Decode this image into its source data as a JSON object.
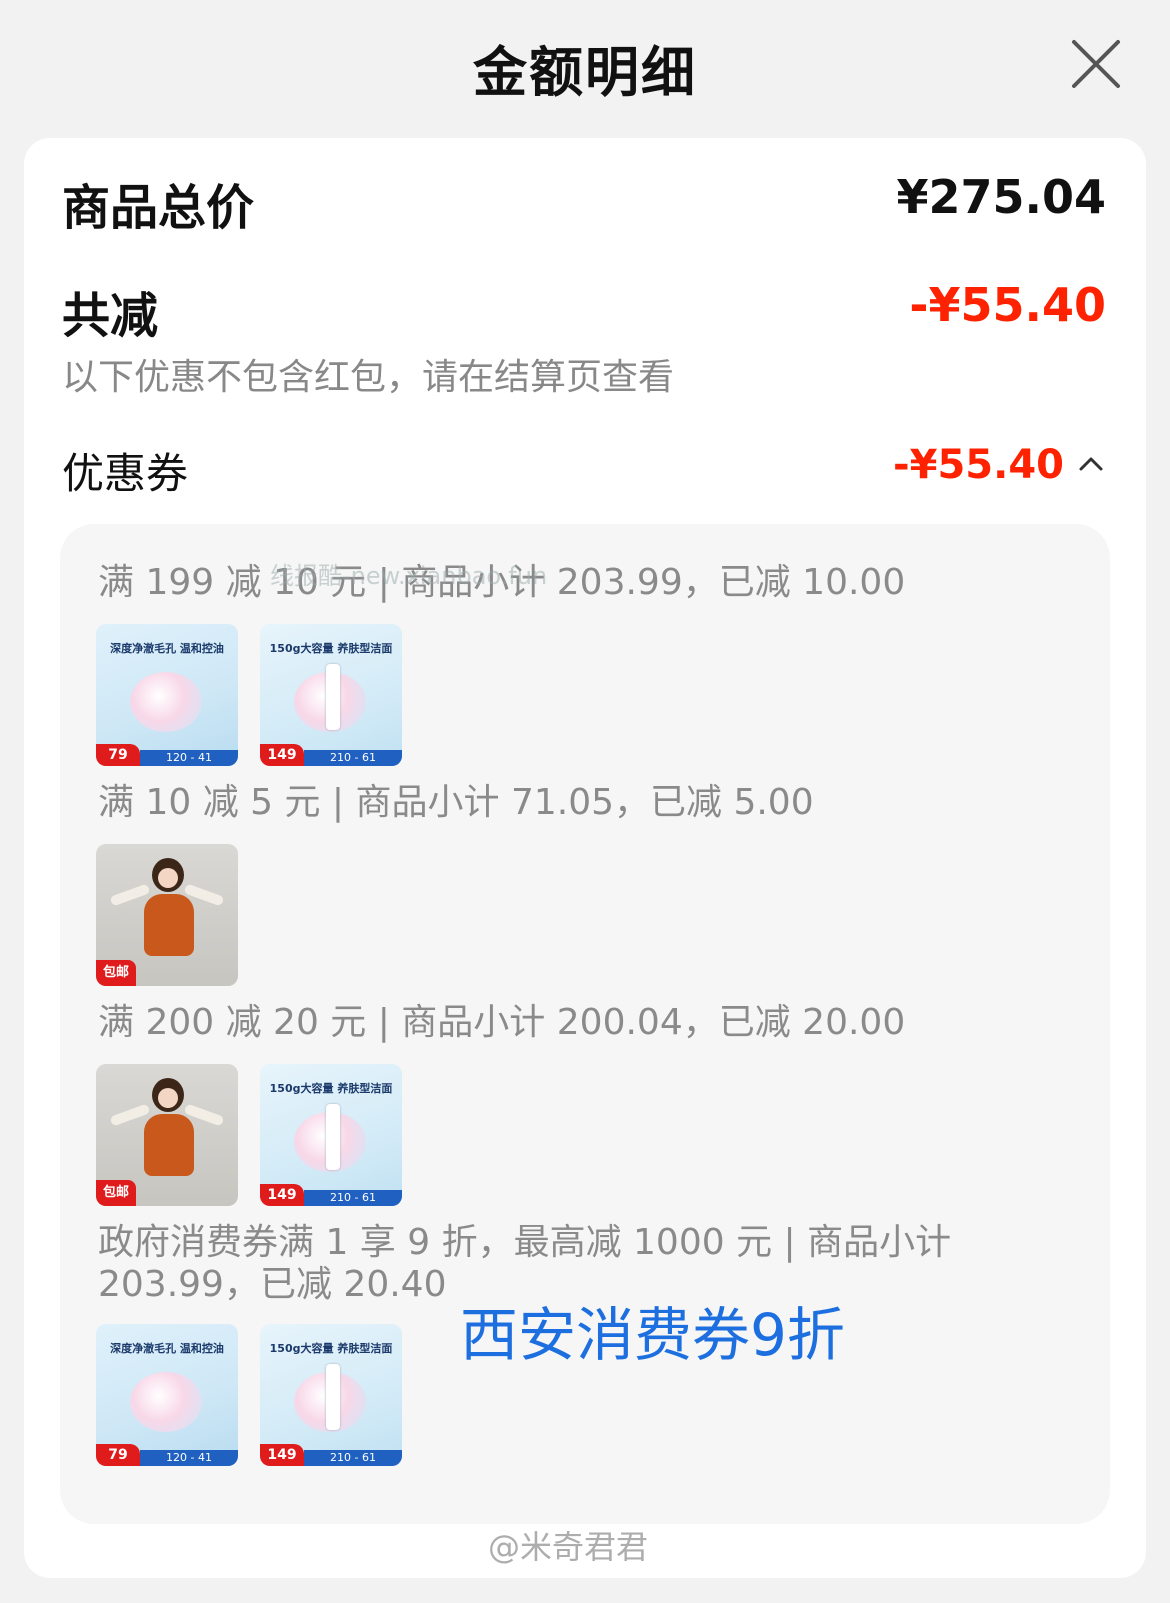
{
  "header": {
    "title": "金额明细"
  },
  "summary": {
    "total_label": "商品总价",
    "total_value": "¥275.04",
    "discount_label": "共减",
    "discount_value": "-¥55.40",
    "note": "以下优惠不包含红包，请在结算页查看",
    "coupon_label": "优惠券",
    "coupon_value": "-¥55.40"
  },
  "coupon_groups": [
    {
      "title": "满 199 减 10 元 | 商品小计 203.99，已减 10.00",
      "items": [
        {
          "kind": "cosmetic",
          "caption": "深度净澈毛孔 温和控油",
          "price": "79",
          "bar": "120 - 41"
        },
        {
          "kind": "cleanser",
          "caption": "150g大容量 养肤型洁面",
          "price": "149",
          "bar": "210 - 61"
        }
      ]
    },
    {
      "title": "满 10 减 5 元 | 商品小计 71.05，已减 5.00",
      "items": [
        {
          "kind": "dress",
          "ship": "包邮"
        }
      ]
    },
    {
      "title": "满 200 减 20 元 | 商品小计 200.04，已减 20.00",
      "items": [
        {
          "kind": "dress",
          "ship": "包邮"
        },
        {
          "kind": "cleanser",
          "caption": "150g大容量 养肤型洁面",
          "price": "149",
          "bar": "210 - 61"
        }
      ]
    },
    {
      "title": "政府消费券满 1 享 9 折，最高减 1000 元 | 商品小计 203.99，已减 20.40",
      "items": [
        {
          "kind": "cosmetic",
          "caption": "深度净澈毛孔 温和控油",
          "price": "79",
          "bar": "120 - 41"
        },
        {
          "kind": "cleanser",
          "caption": "150g大容量 养肤型洁面",
          "price": "149",
          "bar": "210 - 61"
        }
      ]
    }
  ],
  "overlay_text": "西安消费券9折",
  "watermark": "@米奇君君",
  "watermark_mid": "线报酷-new.xianbao.fun",
  "colors": {
    "accent_red": "#ff2200",
    "overlay_blue": "#1d6fe0",
    "background": "#f2f2f2"
  },
  "icons": {
    "close": "close-icon",
    "collapse": "chevron-up-icon"
  }
}
